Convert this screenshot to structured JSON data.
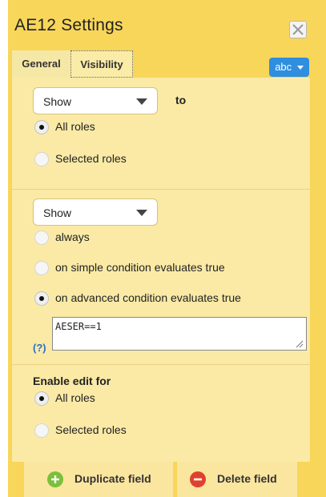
{
  "dialog": {
    "title": "AE12 Settings"
  },
  "tabs": [
    {
      "label": "General",
      "active": false
    },
    {
      "label": "Visibility",
      "active": true
    }
  ],
  "format_button": {
    "label": "abc"
  },
  "visibility": {
    "mode_select": {
      "value": "Show"
    },
    "to_label": "to",
    "roles": [
      {
        "label": "All roles",
        "checked": true
      },
      {
        "label": "Selected roles",
        "checked": false
      }
    ]
  },
  "condition": {
    "mode_select": {
      "value": "Show"
    },
    "options": [
      {
        "label": "always",
        "checked": false
      },
      {
        "label": "on simple condition evaluates true",
        "checked": false
      },
      {
        "label": "on advanced condition evaluates true",
        "checked": true
      }
    ],
    "help_link": "(?)",
    "expression": "AESER==1"
  },
  "edit": {
    "title": "Enable edit for",
    "roles": [
      {
        "label": "All roles",
        "checked": true
      },
      {
        "label": "Selected roles",
        "checked": false
      }
    ]
  },
  "footer": {
    "duplicate_label": "Duplicate field",
    "delete_label": "Delete field"
  },
  "colors": {
    "panel": "#f7d65a",
    "content": "#faeaa6",
    "accent_blue": "#2f8ee0",
    "add_green": "#7cbf3d",
    "delete_red": "#e0412f"
  }
}
